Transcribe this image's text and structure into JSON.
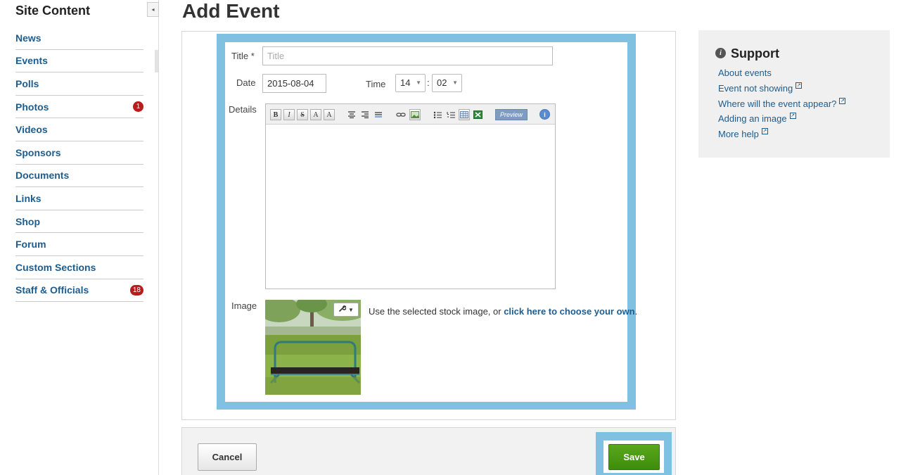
{
  "sidebar": {
    "title": "Site Content",
    "collapse_glyph": "◂",
    "items": [
      {
        "label": "News",
        "badge": ""
      },
      {
        "label": "Events",
        "badge": ""
      },
      {
        "label": "Polls",
        "badge": ""
      },
      {
        "label": "Photos",
        "badge": "1"
      },
      {
        "label": "Videos",
        "badge": ""
      },
      {
        "label": "Sponsors",
        "badge": ""
      },
      {
        "label": "Documents",
        "badge": ""
      },
      {
        "label": "Links",
        "badge": ""
      },
      {
        "label": "Shop",
        "badge": ""
      },
      {
        "label": "Forum",
        "badge": ""
      },
      {
        "label": "Custom Sections",
        "badge": ""
      },
      {
        "label": "Staff & Officials",
        "badge": "18"
      }
    ]
  },
  "page": {
    "title": "Add Event"
  },
  "form": {
    "title_label": "Title *",
    "title_placeholder": "Title",
    "title_value": "",
    "date_label": "Date",
    "date_value": "2015-08-04",
    "time_label": "Time",
    "hour_value": "14",
    "minute_value": "02",
    "time_separator": ":",
    "details_label": "Details",
    "toolbar": {
      "bold": "B",
      "italic": "I",
      "strike": "S",
      "font_size_up": "A",
      "font_size_down": "A",
      "preview": "Preview",
      "info": "i"
    },
    "image_label": "Image",
    "image_text_prefix": "Use the selected stock image, or ",
    "image_link": "click here to choose your own",
    "image_text_suffix": ".",
    "image_tool_glyph": "🔧 ▾"
  },
  "footer": {
    "cancel_label": "Cancel",
    "save_label": "Save"
  },
  "support": {
    "icon": "i",
    "title": "Support",
    "links": [
      "About events",
      "Event not showing",
      "Where will the event appear?",
      "Adding an image",
      "More help"
    ]
  },
  "colors": {
    "link": "#1d5c8e",
    "highlight": "#80c0e1",
    "save_green": "#4a9a14",
    "badge_red": "#b81c1c"
  }
}
